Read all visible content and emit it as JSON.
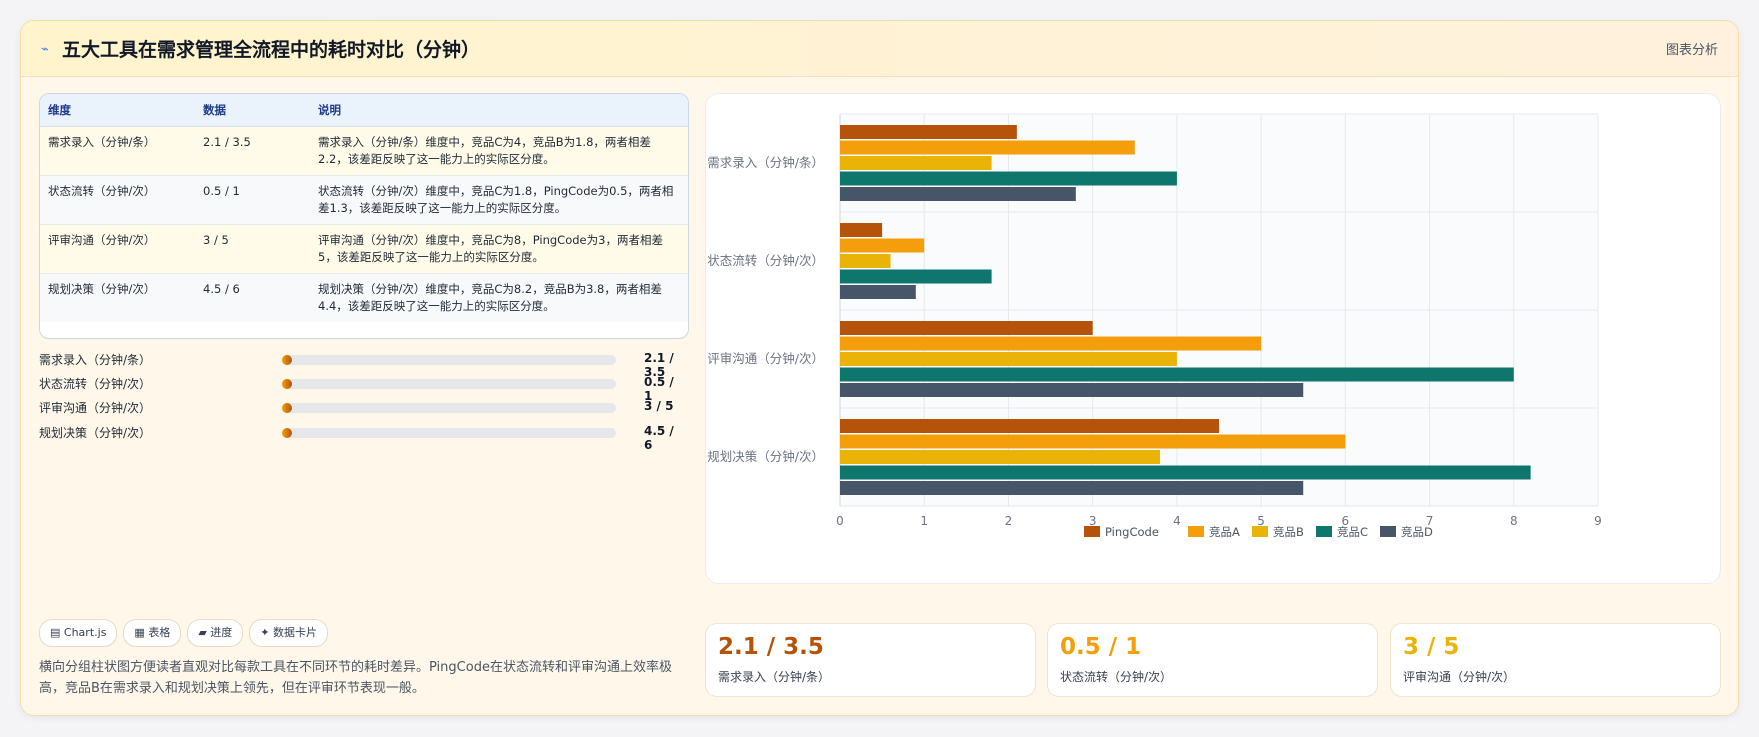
{
  "header": {
    "icon": "chart-pulse-icon",
    "title": "五大工具在需求管理全流程中的耗时对比（分钟）",
    "link_label": "图表分析"
  },
  "table": {
    "headers": [
      "维度",
      "数据",
      "说明"
    ],
    "rows": [
      {
        "dim": "需求录入（分钟/条）",
        "data": "2.1 / 3.5",
        "note": "需求录入（分钟/条）维度中，竞品C为4，竞品B为1.8，两者相差2.2，该差距反映了这一能力上的实际区分度。"
      },
      {
        "dim": "状态流转（分钟/次）",
        "data": "0.5 / 1",
        "note": "状态流转（分钟/次）维度中，竞品C为1.8，PingCode为0.5，两者相差1.3，该差距反映了这一能力上的实际区分度。"
      },
      {
        "dim": "评审沟通（分钟/次）",
        "data": "3 / 5",
        "note": "评审沟通（分钟/次）维度中，竞品C为8，PingCode为3，两者相差5，该差距反映了这一能力上的实际区分度。"
      },
      {
        "dim": "规划决策（分钟/次）",
        "data": "4.5 / 6",
        "note": "规划决策（分钟/次）维度中，竞品C为8.2，竞品B为3.8，两者相差4.4，该差距反映了这一能力上的实际区分度。"
      }
    ]
  },
  "progress": [
    {
      "label": "需求录入（分钟/条）",
      "value": "2.1 / 3.5",
      "fill_fraction": 0.03
    },
    {
      "label": "状态流转（分钟/次）",
      "value": "0.5 / 1",
      "fill_fraction": 0.03
    },
    {
      "label": "评审沟通（分钟/次）",
      "value": "3 / 5",
      "fill_fraction": 0.03
    },
    {
      "label": "规划决策（分钟/次）",
      "value": "4.5 / 6",
      "fill_fraction": 0.03
    }
  ],
  "tags": [
    {
      "icon": "chart-icon",
      "glyph": "▤",
      "label": "Chart.js"
    },
    {
      "icon": "table-icon",
      "glyph": "▦",
      "label": "表格"
    },
    {
      "icon": "progress-icon",
      "glyph": "▰",
      "label": "进度"
    },
    {
      "icon": "sparkle-icon",
      "glyph": "✦",
      "label": "数据卡片"
    }
  ],
  "description": "横向分组柱状图方便读者直观对比每款工具在不同环节的耗时差异。PingCode在状态流转和评审沟通上效率极高，竞品B在需求录入和规划决策上领先，但在评审环节表现一般。",
  "stats": [
    {
      "value": "2.1 / 3.5",
      "caption": "需求录入（分钟/条）",
      "color": "#b45309"
    },
    {
      "value": "0.5 / 1",
      "caption": "状态流转（分钟/次）",
      "color": "#f59e0b"
    },
    {
      "value": "3 / 5",
      "caption": "评审沟通（分钟/次）",
      "color": "#eab308"
    }
  ],
  "chart_data": {
    "type": "bar",
    "orientation": "horizontal",
    "categories": [
      "需求录入（分钟/条）",
      "状态流转（分钟/次）",
      "评审沟通（分钟/次）",
      "规划决策（分钟/次）"
    ],
    "series": [
      {
        "name": "PingCode",
        "color": "#b45309",
        "values": [
          2.1,
          0.5,
          3,
          4.5
        ]
      },
      {
        "name": "竞品A",
        "color": "#f59e0b",
        "values": [
          3.5,
          1,
          5,
          6
        ]
      },
      {
        "name": "竞品B",
        "color": "#eab308",
        "values": [
          1.8,
          0.6,
          4,
          3.8
        ]
      },
      {
        "name": "竞品C",
        "color": "#0f766e",
        "values": [
          4,
          1.8,
          8,
          8.2
        ]
      },
      {
        "name": "竞品D",
        "color": "#475569",
        "values": [
          2.8,
          0.9,
          5.5,
          5.5
        ]
      }
    ],
    "xlim": [
      0,
      9
    ],
    "xticks": [
      0,
      1,
      2,
      3,
      4,
      5,
      6,
      7,
      8,
      9
    ],
    "grid": true,
    "legend_position": "bottom"
  }
}
